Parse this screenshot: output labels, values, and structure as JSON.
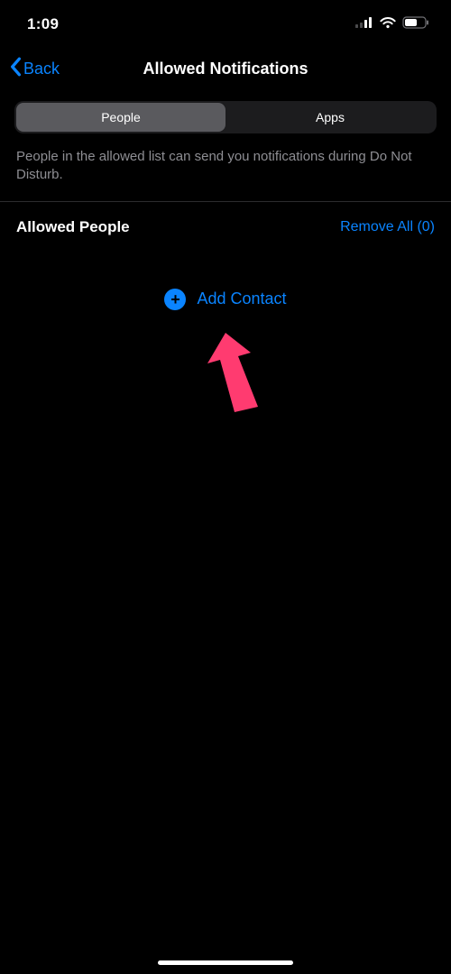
{
  "status": {
    "time": "1:09"
  },
  "nav": {
    "back": "Back",
    "title": "Allowed Notifications"
  },
  "segmented": {
    "people": "People",
    "apps": "Apps"
  },
  "description": "People in the allowed list can send you notifications during Do Not Disturb.",
  "section": {
    "title": "Allowed People",
    "remove_all": "Remove All (0)"
  },
  "add_contact": "Add Contact"
}
